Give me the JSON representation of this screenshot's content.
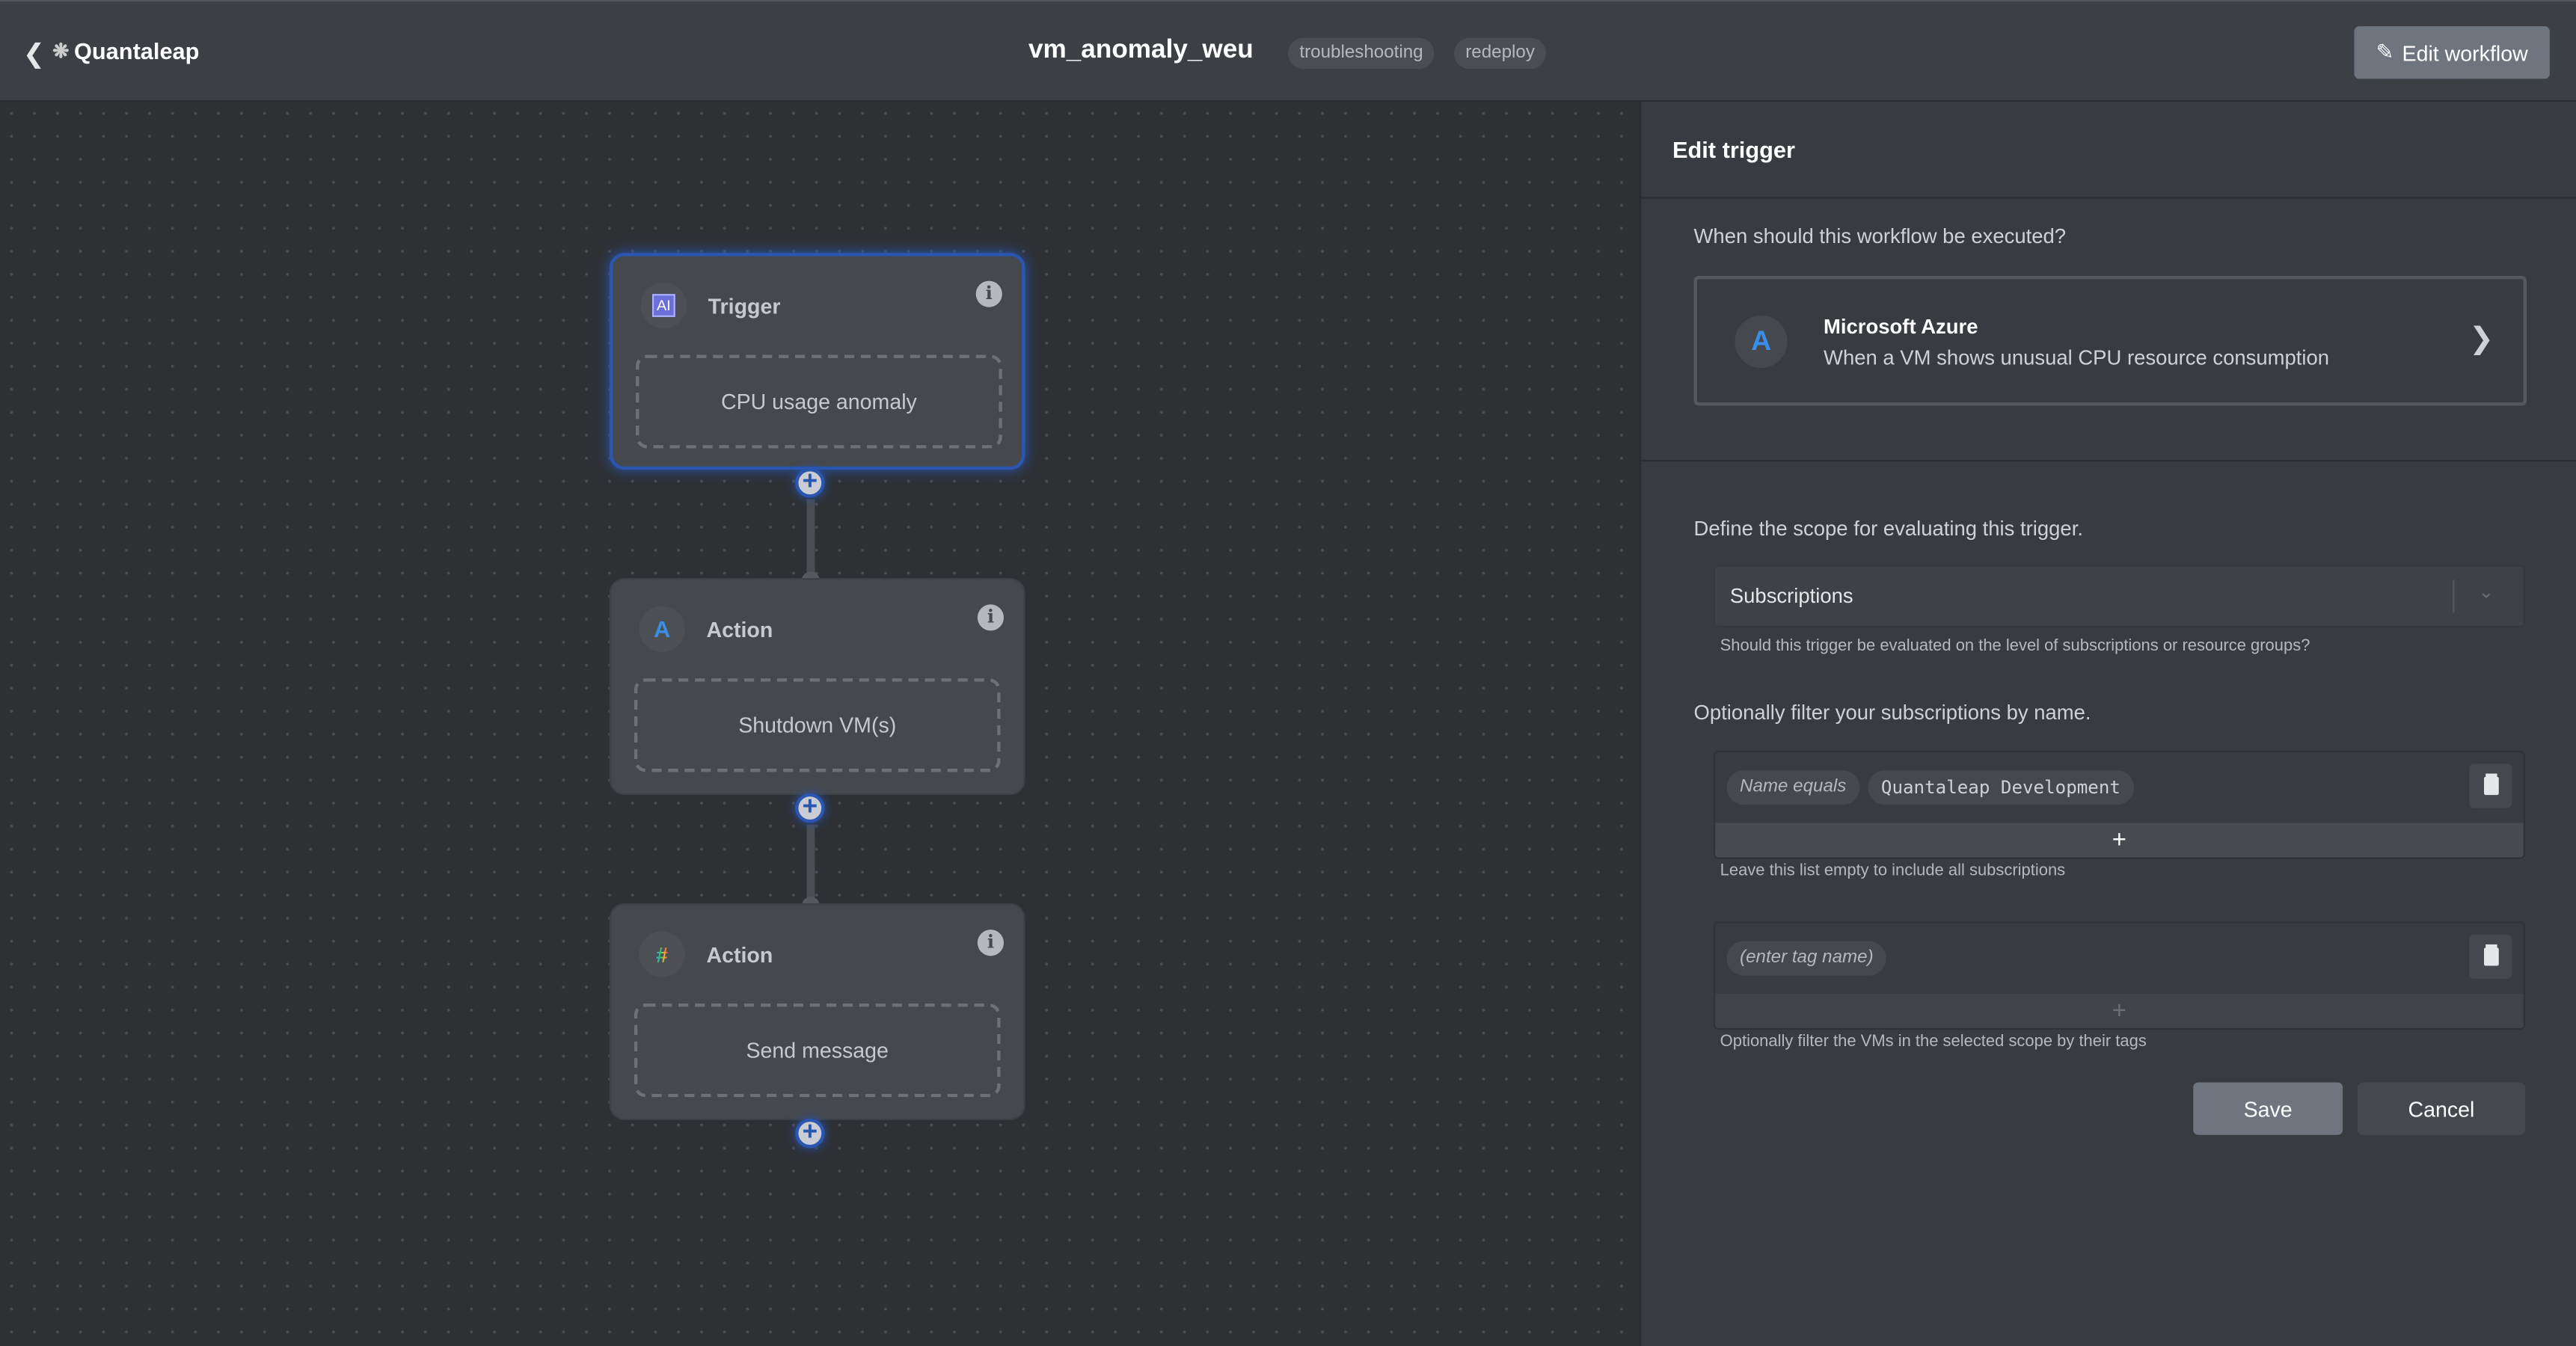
{
  "header": {
    "back_icon": "chevron-left-icon",
    "logo_text": "Quantaleap",
    "workflow_title": "vm_anomaly_weu",
    "tags": [
      "troubleshooting",
      "redeploy"
    ],
    "edit_workflow_label": "Edit workflow"
  },
  "canvas": {
    "nodes": [
      {
        "type": "Trigger",
        "icon": "ai-chip-icon",
        "body": "CPU usage anomaly",
        "selected": true
      },
      {
        "type": "Action",
        "icon": "azure-icon",
        "body": "Shutdown VM(s)",
        "selected": false
      },
      {
        "type": "Action",
        "icon": "slack-icon",
        "body": "Send message",
        "selected": false
      }
    ]
  },
  "panel": {
    "title": "Edit trigger",
    "question": "When should this workflow be executed?",
    "trigger": {
      "provider": "Microsoft Azure",
      "description": "When a VM shows unusual CPU resource consumption"
    },
    "scope_label": "Define the scope for evaluating this trigger.",
    "scope_value": "Subscriptions",
    "scope_help": "Should this trigger be evaluated on the level of subscriptions or resource groups?",
    "name_filter_label": "Optionally filter your subscriptions by name.",
    "name_filter": {
      "operator": "Name equals",
      "value": "Quantaleap Development"
    },
    "name_filter_help": "Leave this list empty to include all subscriptions",
    "tag_filter": {
      "placeholder": "(enter tag name)"
    },
    "tag_filter_help": "Optionally filter the VMs in the selected scope by their tags",
    "save_label": "Save",
    "cancel_label": "Cancel",
    "add_symbol": "+"
  },
  "colors": {
    "accent": "#2a56b0",
    "header": "#3c3f44",
    "panel": "#383b40",
    "canvas": "#2e3034"
  }
}
